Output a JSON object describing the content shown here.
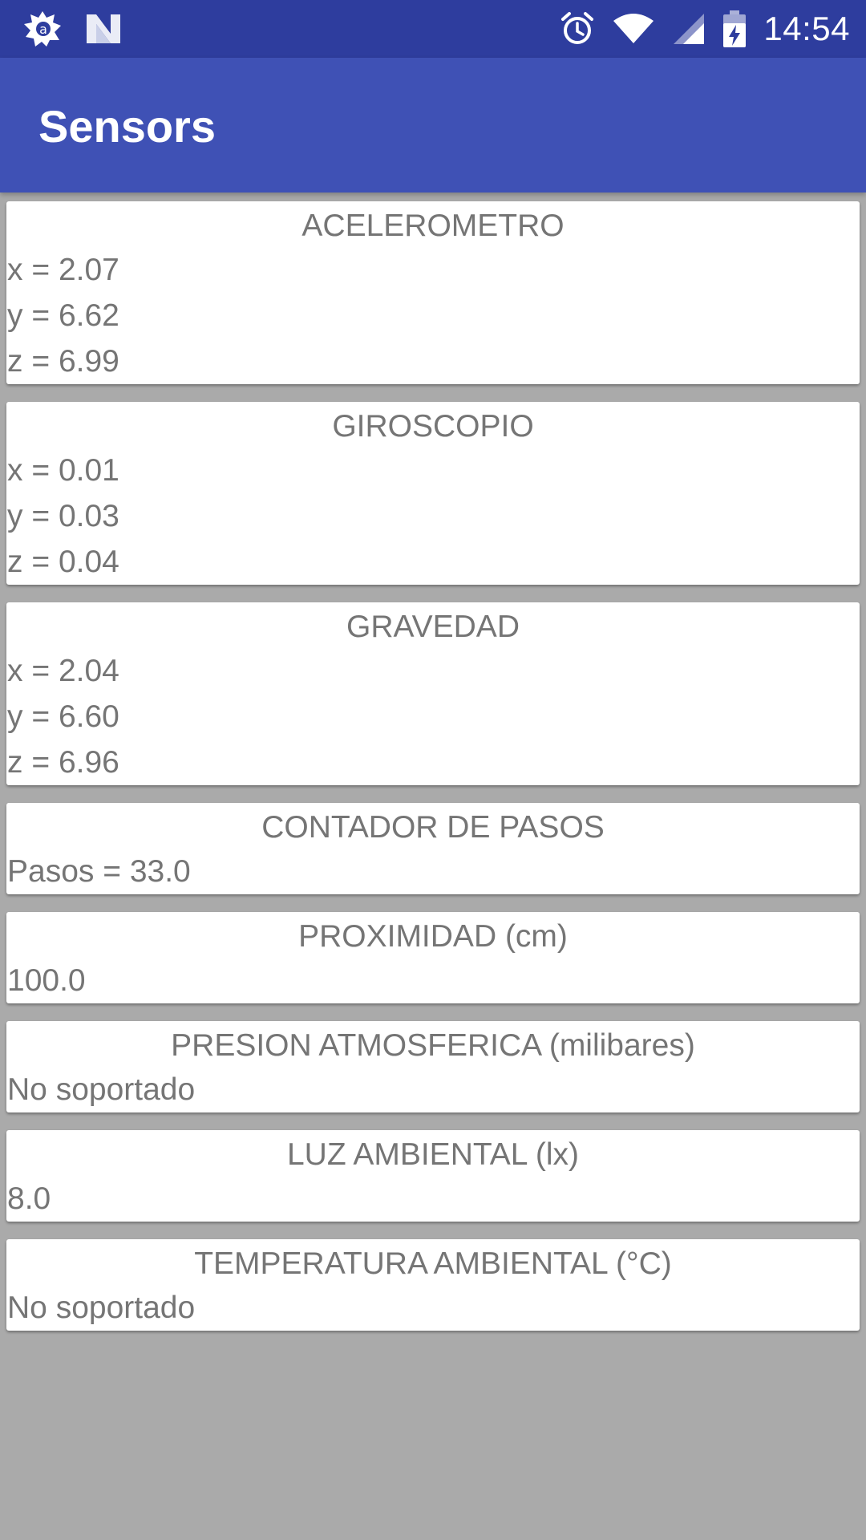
{
  "status_bar": {
    "time": "14:54",
    "icons": [
      "app-notification-icon",
      "n-notification-icon",
      "alarm-icon",
      "wifi-icon",
      "cell-signal-icon",
      "battery-charging-icon"
    ]
  },
  "app_bar": {
    "title": "Sensors"
  },
  "cards": [
    {
      "title": "ACELEROMETRO",
      "lines": [
        "x = 2.07",
        "y = 6.62",
        "z = 6.99"
      ]
    },
    {
      "title": "GIROSCOPIO",
      "lines": [
        "x = 0.01",
        "y = 0.03",
        "z = 0.04"
      ]
    },
    {
      "title": "GRAVEDAD",
      "lines": [
        "x = 2.04",
        "y = 6.60",
        "z = 6.96"
      ]
    },
    {
      "title": "CONTADOR DE PASOS",
      "lines": [
        "Pasos = 33.0"
      ]
    },
    {
      "title": "PROXIMIDAD (cm)",
      "lines": [
        "100.0"
      ]
    },
    {
      "title": "PRESION ATMOSFERICA (milibares)",
      "lines": [
        "No soportado"
      ]
    },
    {
      "title": "LUZ AMBIENTAL (lx)",
      "lines": [
        "8.0"
      ]
    },
    {
      "title": "TEMPERATURA AMBIENTAL (°C)",
      "lines": [
        "No soportado"
      ]
    }
  ],
  "colors": {
    "status_bar": "#2e3d9e",
    "app_bar": "#3f51b5",
    "background": "#aaaaaa",
    "card": "#ffffff",
    "card_text": "#757575"
  }
}
